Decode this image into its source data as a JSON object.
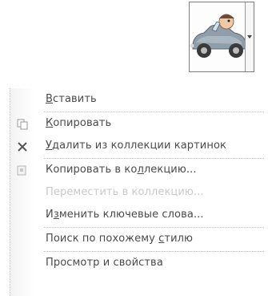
{
  "clipart": {
    "icon": "car-driver-clipart",
    "dropdown_icon": "chevron-down-icon"
  },
  "menu": {
    "items": [
      {
        "accel": "В",
        "rest": "ставить",
        "enabled": true,
        "icon": ""
      },
      {
        "accel": "К",
        "rest": "опировать",
        "enabled": true,
        "icon": "copy-icon"
      },
      {
        "accel": "У",
        "rest": "далить из коллекции картинок",
        "enabled": true,
        "icon": "delete-x-icon"
      },
      {
        "pre": "Копировать в ко",
        "accel": "л",
        "post": "лекцию...",
        "enabled": true,
        "icon": "copy-to-collection-icon"
      },
      {
        "text": "Переместить в коллекцию...",
        "enabled": false,
        "icon": ""
      },
      {
        "pre": "И",
        "accel": "з",
        "post": "менить ключевые слова...",
        "enabled": true,
        "icon": ""
      },
      {
        "pre": "Поиск по похожему ",
        "accel": "с",
        "post": "тилю",
        "enabled": true,
        "icon": ""
      },
      {
        "pre": "Просмотр и свойства",
        "accel": "",
        "post": "",
        "enabled": true,
        "icon": ""
      }
    ]
  }
}
